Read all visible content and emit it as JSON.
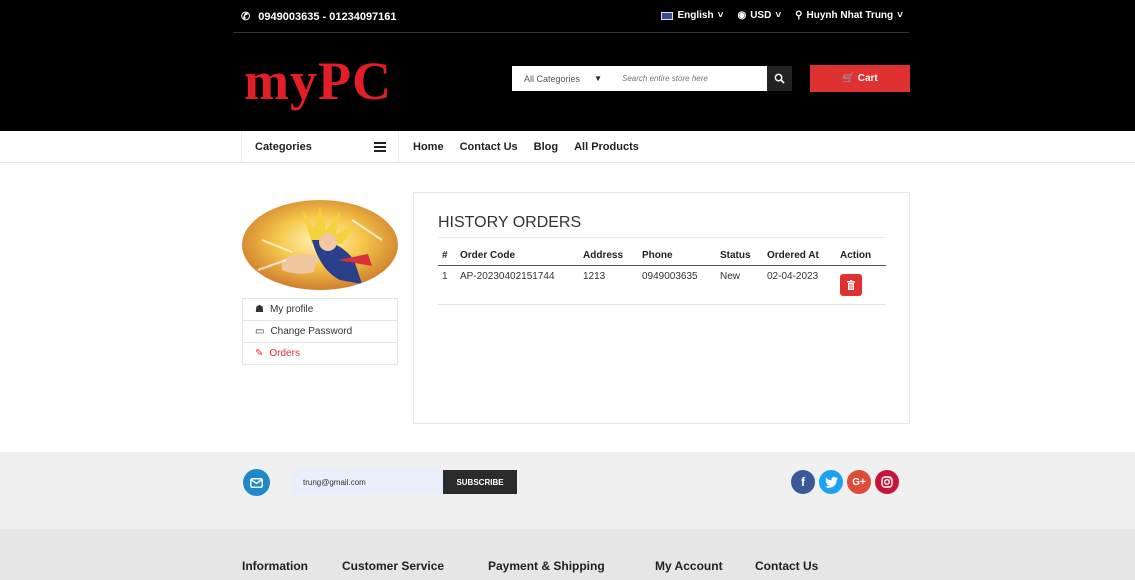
{
  "topbar": {
    "phone": "0949003635 - 01234097161",
    "language": "English",
    "currency": "USD",
    "user": "Huynh Nhat Trung"
  },
  "logo": "myPC",
  "search": {
    "category": "All Categories",
    "placeholder": "Search entire store here"
  },
  "cart_label": "Cart",
  "nav": {
    "categories": "Categories",
    "links": [
      "Home",
      "Contact Us",
      "Blog",
      "All Products"
    ]
  },
  "sidebar": {
    "items": [
      {
        "label": "My profile",
        "icon": "home-icon"
      },
      {
        "label": "Change Password",
        "icon": "card-icon"
      },
      {
        "label": "Orders",
        "icon": "pencil-icon"
      }
    ]
  },
  "orders": {
    "title": "HISTORY ORDERS",
    "columns": [
      "#",
      "Order Code",
      "Address",
      "Phone",
      "Status",
      "Ordered At",
      "Action"
    ],
    "rows": [
      {
        "index": "1",
        "code": "AP-20230402151744",
        "address": "1213",
        "phone": "0949003635",
        "status": "New",
        "ordered_at": "02-04-2023"
      }
    ]
  },
  "newsletter": {
    "email": "trung@gmail.com",
    "subscribe": "SUBSCRIBE"
  },
  "socials": [
    "f",
    "t",
    "G+",
    "ig"
  ],
  "footer": {
    "links": [
      "Information",
      "Customer Service",
      "Payment & Shipping",
      "My Account",
      "Contact Us"
    ]
  },
  "colors": {
    "accent": "#e03131",
    "header": "#000000",
    "facebook": "#3b5998",
    "twitter": "#1da1f2",
    "google": "#dd4b39",
    "instagram": "#c4163b"
  }
}
